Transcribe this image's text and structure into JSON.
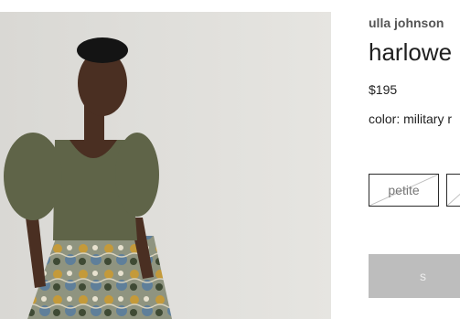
{
  "product": {
    "brand": "ulla johnson",
    "title": "harlowe",
    "price": "$195",
    "color_line": "color: military r"
  },
  "sizes": [
    {
      "label": "petite",
      "available": false
    },
    {
      "label": "",
      "available": false
    }
  ],
  "cta": {
    "label": "s"
  },
  "colors": {
    "cta_bg": "#bdbdbd",
    "top_olive": "#5f6448",
    "photo_bg": "#e2e1dd"
  }
}
